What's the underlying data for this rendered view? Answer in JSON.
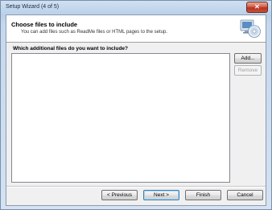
{
  "window": {
    "title": "Setup Wizard (4 of 5)",
    "close_glyph": "✕"
  },
  "header": {
    "title": "Choose files to include",
    "description": "You can add files such as ReadMe files or HTML pages to the setup.",
    "icon": "setup-disc-icon"
  },
  "main": {
    "prompt": "Which additional files do you want to include?",
    "files": [],
    "add_label": "Add...",
    "remove_label": "Remove"
  },
  "footer": {
    "previous_label": "< Previous",
    "next_label": "Next >",
    "finish_label": "Finish",
    "cancel_label": "Cancel"
  }
}
